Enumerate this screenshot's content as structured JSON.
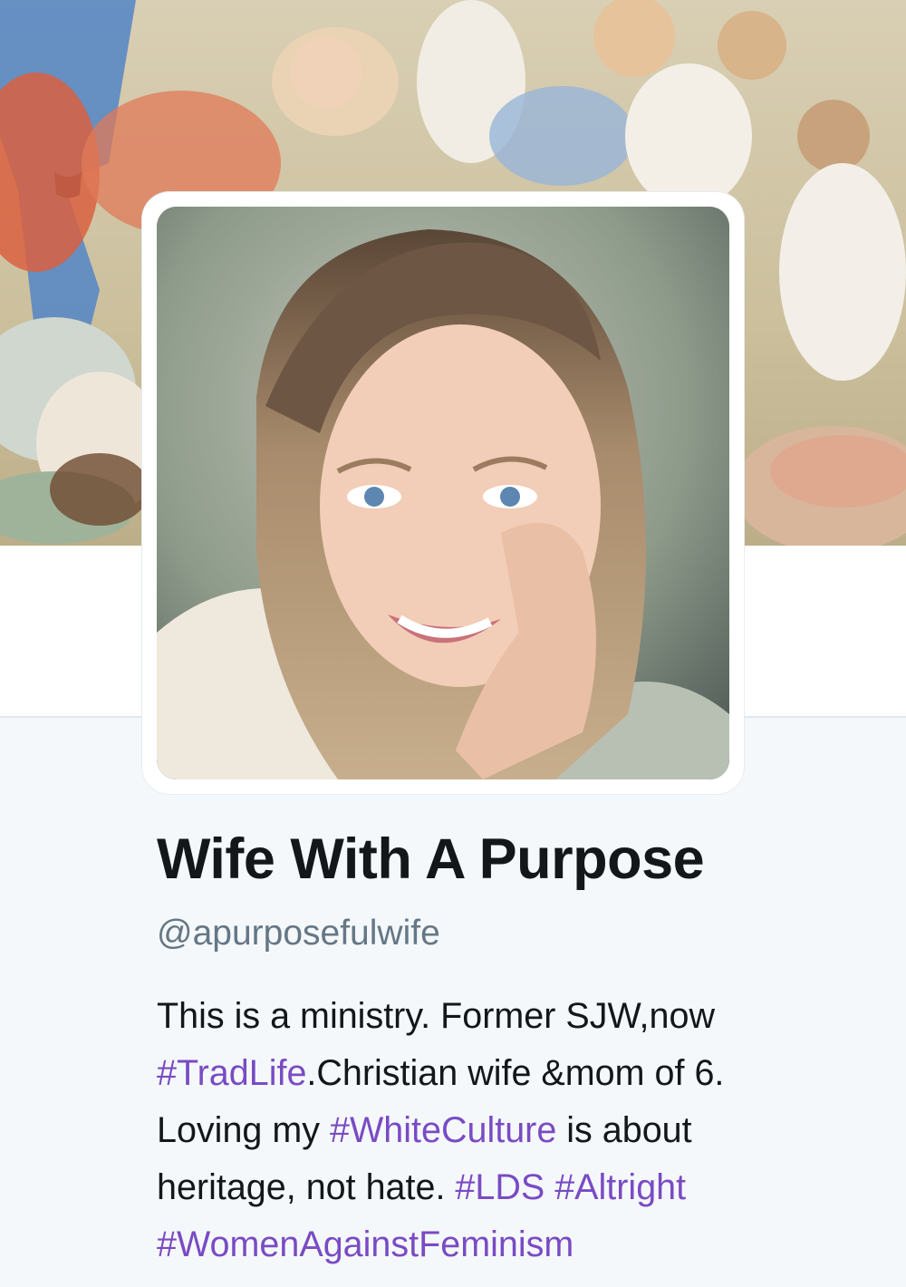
{
  "profile": {
    "display_name": "Wife With A Purpose",
    "handle": "@apurposefulwife",
    "banner_image": "illustrated-children-painting",
    "avatar_image": "woman-selfie-photo"
  },
  "bio": {
    "line1": {
      "text_a": "This is a ministry. Former SJW,now"
    },
    "line2": {
      "tag_a": "#TradLife",
      "text_a": ".Christian wife &mom of 6."
    },
    "line3": {
      "text_a": "Loving my ",
      "tag_a": "#WhiteCulture",
      "text_b": " is about"
    },
    "line4": {
      "text_a": "heritage, not hate. ",
      "tag_a": "#LDS",
      "text_b": " ",
      "tag_b": "#Altright"
    },
    "line5": {
      "tag_a": "#WomenAgainstFeminism"
    }
  },
  "colors": {
    "hashtag": "#794bc4",
    "name": "#14171a",
    "handle": "#657786",
    "page_background": "#f5f8fa"
  }
}
